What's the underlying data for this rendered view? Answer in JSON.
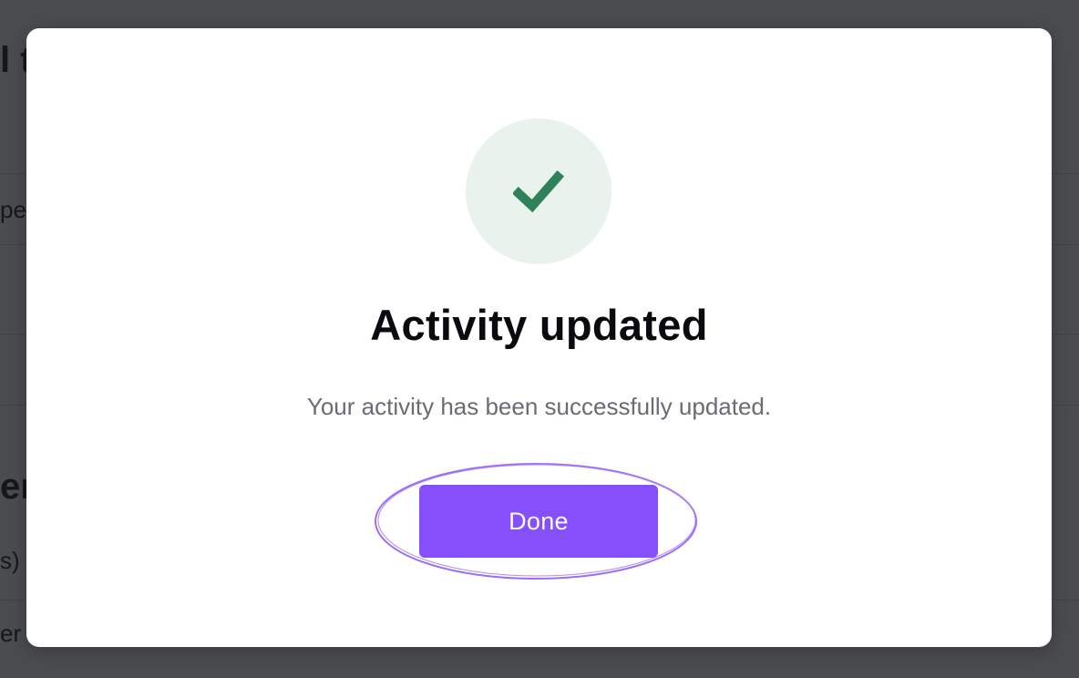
{
  "background": {
    "title_fragment": "l t",
    "row1_fragment": "pe",
    "section_fragment": "er",
    "row2_fragment": "s)",
    "row3_fragment": "er"
  },
  "modal": {
    "icon": "checkmark-icon",
    "title": "Activity updated",
    "message": "Your activity has been successfully updated.",
    "done_label": "Done"
  },
  "colors": {
    "accent": "#8550fb",
    "success": "#2f8159",
    "success_bg": "#eaf2ed",
    "overlay": "#3f4045"
  }
}
